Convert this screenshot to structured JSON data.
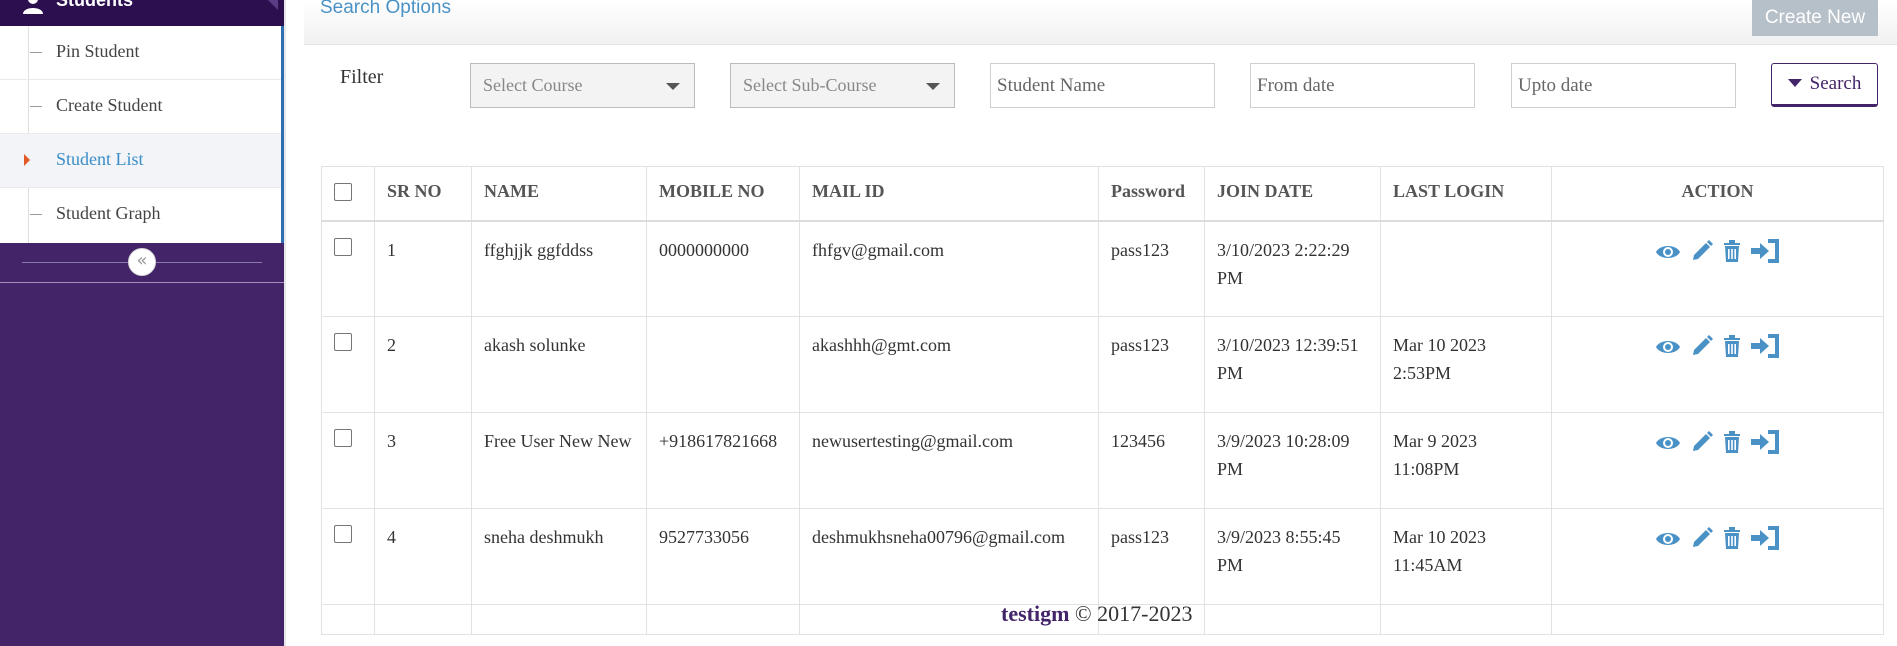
{
  "sidebar": {
    "header": "Students",
    "items": [
      {
        "label": "Pin Student"
      },
      {
        "label": "Create Student"
      },
      {
        "label": "Student List"
      },
      {
        "label": "Student Graph"
      }
    ],
    "collapse_icon": "double-chevron-left-icon"
  },
  "topbar": {
    "title": "Search Options",
    "create_new": "Create New"
  },
  "filter": {
    "label": "Filter",
    "course_placeholder": "Select Course",
    "subcourse_placeholder": "Select Sub-Course",
    "name_placeholder": "Student Name",
    "from_placeholder": "From date",
    "upto_placeholder": "Upto date",
    "search_label": "Search"
  },
  "table": {
    "headers": [
      "SR NO",
      "NAME",
      "MOBILE NO",
      "MAIL ID",
      "Password",
      "JOIN DATE",
      "LAST LOGIN",
      "ACTION"
    ],
    "rows": [
      {
        "sr": "1",
        "name": "ffghjjk ggfddss",
        "mobile": "0000000000",
        "mail": "fhfgv@gmail.com",
        "password": "pass123",
        "join": "3/10/2023 2:22:29 PM",
        "last": ""
      },
      {
        "sr": "2",
        "name": "akash solunke",
        "mobile": "",
        "mail": "akashhh@gmt.com",
        "password": "pass123",
        "join": "3/10/2023 12:39:51 PM",
        "last": "Mar 10 2023 2:53PM"
      },
      {
        "sr": "3",
        "name": "Free User New New",
        "mobile": "+918617821668",
        "mail": "newusertesting@gmail.com",
        "password": "123456",
        "join": "3/9/2023 10:28:09 PM",
        "last": "Mar 9 2023 11:08PM"
      },
      {
        "sr": "4",
        "name": "sneha deshmukh",
        "mobile": "9527733056",
        "mail": "deshmukhsneha00796@gmail.com",
        "password": "pass123",
        "join": "3/9/2023 8:55:45 PM",
        "last": "Mar 10 2023 11:45AM"
      }
    ],
    "action_icons": [
      "eye-icon",
      "pencil-icon",
      "trash-icon",
      "login-icon"
    ],
    "icon_color": "#4a92c6"
  },
  "footer": {
    "brand": "testigm",
    "copyright": "© 2017-2023"
  }
}
